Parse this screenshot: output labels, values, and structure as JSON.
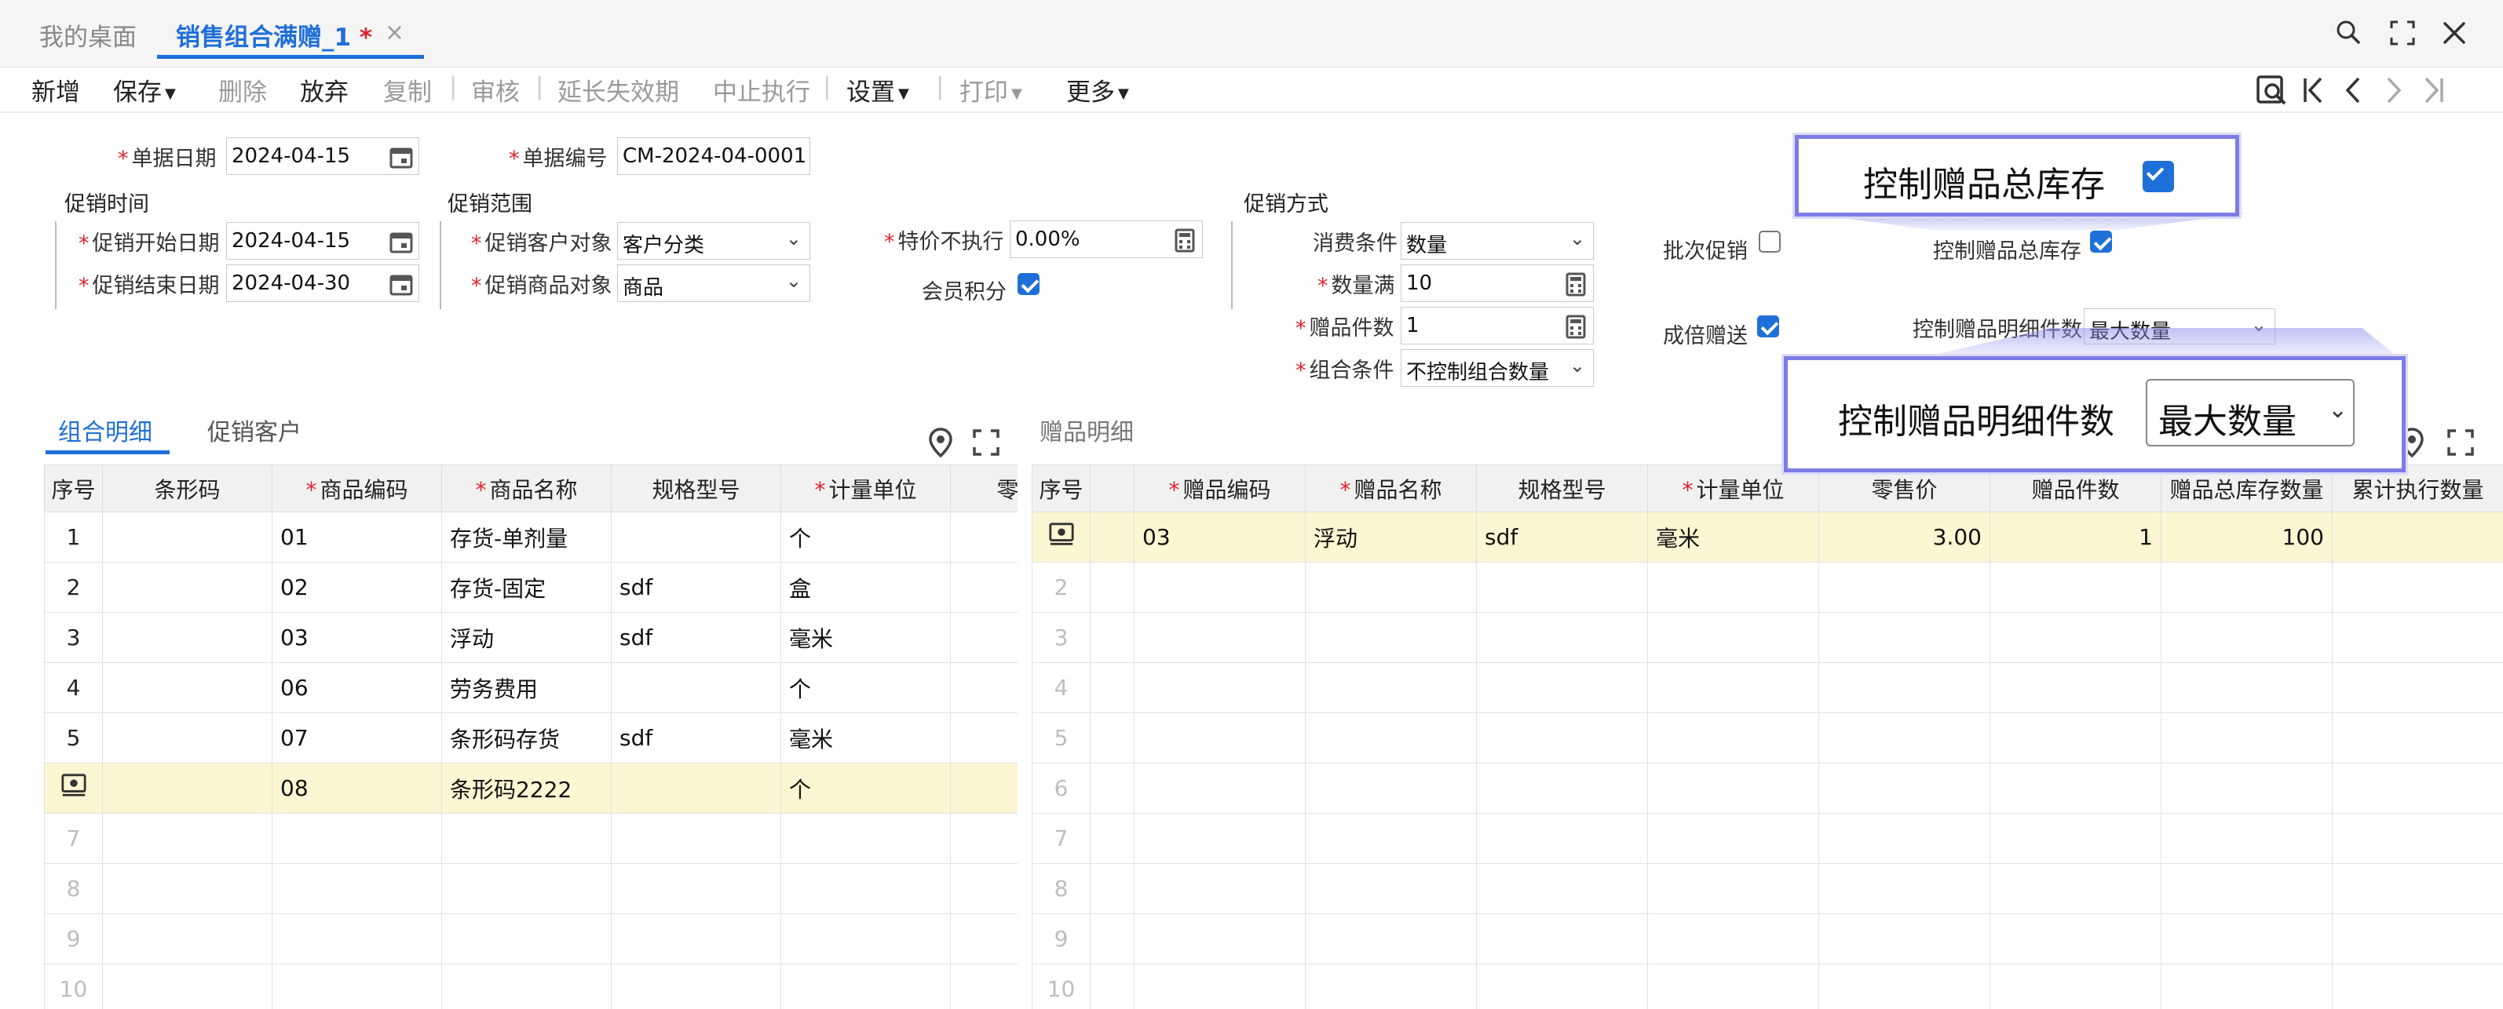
{
  "tabs": {
    "home": "我的桌面",
    "active": "销售组合满赠_1",
    "active_dirty": "*",
    "close": "×"
  },
  "toolbar": {
    "add": "新增",
    "save": "保存",
    "delete": "删除",
    "abandon": "放弃",
    "copy": "复制",
    "audit": "审核",
    "extend": "延长失效期",
    "stop": "中止执行",
    "settings": "设置",
    "print": "打印",
    "more": "更多",
    "sep": "|"
  },
  "form": {
    "doc_date_label": "单据日期",
    "doc_date": "2024-04-15",
    "doc_no_label": "单据编号",
    "doc_no": "CM-2024-04-0001",
    "promo_time": "促销时间",
    "start_label": "促销开始日期",
    "start_date": "2024-04-15",
    "end_label": "促销结束日期",
    "end_date": "2024-04-30",
    "promo_scope": "促销范围",
    "customer_obj_label": "促销客户对象",
    "customer_obj": "客户分类",
    "goods_obj_label": "促销商品对象",
    "goods_obj": "商品",
    "special_label": "特价不执行",
    "special_value": "0.00%",
    "member_points_label": "会员积分",
    "promo_method": "促销方式",
    "consume_cond_label": "消费条件",
    "consume_cond": "数量",
    "qty_full_label": "数量满",
    "qty_full": "10",
    "gift_count_label": "赠品件数",
    "gift_count": "1",
    "combo_cond_label": "组合条件",
    "combo_cond": "不控制组合数量",
    "batch_promo_label": "批次促销",
    "multiple_gift_label": "成倍赠送",
    "ctrl_stock_label": "控制赠品总库存",
    "ctrl_detail_label": "控制赠品明细件数",
    "ctrl_detail_value": "最大数量"
  },
  "checkboxes": {
    "member_points": true,
    "batch_promo": false,
    "ctrl_stock": true,
    "multiple_gift": true
  },
  "callouts": {
    "stock": {
      "label": "控制赠品总库存"
    },
    "detail": {
      "label": "控制赠品明细件数",
      "value": "最大数量"
    }
  },
  "left_tabs": {
    "combo": "组合明细",
    "customer": "促销客户"
  },
  "left_table": {
    "headers": [
      "序号",
      "条形码",
      "商品编码",
      "商品名称",
      "规格型号",
      "计量单位",
      "零"
    ],
    "rows": [
      {
        "no": "1",
        "barcode": "",
        "code": "01",
        "name": "存货-单剂量",
        "spec": "",
        "unit": "个"
      },
      {
        "no": "2",
        "barcode": "",
        "code": "02",
        "name": "存货-固定",
        "spec": "sdf",
        "unit": "盒"
      },
      {
        "no": "3",
        "barcode": "",
        "code": "03",
        "name": "浮动",
        "spec": "sdf",
        "unit": "毫米"
      },
      {
        "no": "4",
        "barcode": "",
        "code": "06",
        "name": "劳务费用",
        "spec": "",
        "unit": "个"
      },
      {
        "no": "5",
        "barcode": "",
        "code": "07",
        "name": "条形码存货",
        "spec": "sdf",
        "unit": "毫米"
      },
      {
        "no": "",
        "barcode": "",
        "code": "08",
        "name": "条形码2222",
        "spec": "",
        "unit": "个"
      }
    ],
    "empty_rows": [
      "7",
      "8",
      "9",
      "10"
    ]
  },
  "right_title": "赠品明细",
  "right_table": {
    "headers": [
      "序号",
      "",
      "赠品编码",
      "赠品名称",
      "规格型号",
      "计量单位",
      "零售价",
      "赠品件数",
      "赠品总库存数量",
      "累计执行数量"
    ],
    "rows": [
      {
        "no": "",
        "code": "03",
        "name": "浮动",
        "spec": "sdf",
        "unit": "毫米",
        "price": "3.00",
        "qty": "1",
        "stock": "100",
        "executed": ""
      }
    ],
    "empty_rows": [
      "2",
      "3",
      "4",
      "5",
      "6",
      "7",
      "8",
      "9",
      "10"
    ]
  },
  "colors": {
    "accent": "#1f6fd9",
    "required": "#e0222b",
    "callout_border": "#7b7ce6",
    "row_highlight": "#fdf6d2"
  }
}
